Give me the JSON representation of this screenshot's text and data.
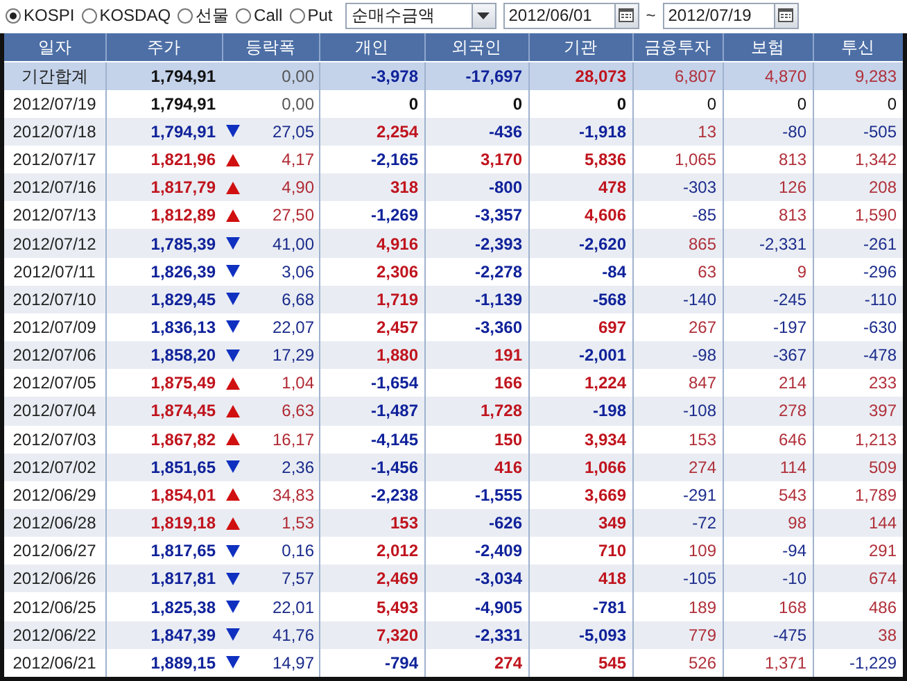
{
  "filters": [
    {
      "label": "KOSPI",
      "selected": true
    },
    {
      "label": "KOSDAQ",
      "selected": false
    },
    {
      "label": "선물",
      "selected": false
    },
    {
      "label": "Call",
      "selected": false
    },
    {
      "label": "Put",
      "selected": false
    }
  ],
  "measure": {
    "value": "순매수금액"
  },
  "date_from": {
    "value": "2012/06/01"
  },
  "range_separator": "~",
  "date_to": {
    "value": "2012/07/19"
  },
  "table": {
    "columns": [
      "일자",
      "주가",
      "등락폭",
      "개인",
      "외국인",
      "기관",
      "금융투자",
      "보험",
      "투신"
    ],
    "rows": [
      {
        "total": true,
        "date": "기간합계",
        "price": "1,794,91",
        "rising": false,
        "falling": false,
        "change": "0,00",
        "values": [
          {
            "text": "-3,978",
            "color": "#10229a"
          },
          {
            "text": "-17,697",
            "color": "#10229a"
          },
          {
            "text": "28,073",
            "color": "#c0141e"
          },
          {
            "text": "6,807",
            "color": "#b0303a"
          },
          {
            "text": "4,870",
            "color": "#b0303a"
          },
          {
            "text": "9,283",
            "color": "#b0303a"
          }
        ]
      },
      {
        "total": false,
        "date": "2012/07/19",
        "price": "1,794,91",
        "rising": false,
        "falling": false,
        "change": "0,00",
        "values": [
          {
            "text": "0",
            "color": "#111111"
          },
          {
            "text": "0",
            "color": "#111111"
          },
          {
            "text": "0",
            "color": "#111111"
          },
          {
            "text": "0",
            "color": "#111111"
          },
          {
            "text": "0",
            "color": "#111111"
          },
          {
            "text": "0",
            "color": "#111111"
          }
        ]
      },
      {
        "total": false,
        "date": "2012/07/18",
        "price": "1,794,91",
        "rising": false,
        "falling": true,
        "change": "27,05",
        "values": [
          {
            "text": "2,254",
            "color": "#c0141e"
          },
          {
            "text": "-436",
            "color": "#10229a"
          },
          {
            "text": "-1,918",
            "color": "#10229a"
          },
          {
            "text": "13",
            "color": "#b0303a"
          },
          {
            "text": "-80",
            "color": "#1c2c8c"
          },
          {
            "text": "-505",
            "color": "#1c2c8c"
          }
        ]
      },
      {
        "total": false,
        "date": "2012/07/17",
        "price": "1,821,96",
        "rising": true,
        "falling": false,
        "change": "4,17",
        "values": [
          {
            "text": "-2,165",
            "color": "#10229a"
          },
          {
            "text": "3,170",
            "color": "#c0141e"
          },
          {
            "text": "5,836",
            "color": "#c0141e"
          },
          {
            "text": "1,065",
            "color": "#b0303a"
          },
          {
            "text": "813",
            "color": "#b0303a"
          },
          {
            "text": "1,342",
            "color": "#b0303a"
          }
        ]
      },
      {
        "total": false,
        "date": "2012/07/16",
        "price": "1,817,79",
        "rising": true,
        "falling": false,
        "change": "4,90",
        "values": [
          {
            "text": "318",
            "color": "#c0141e"
          },
          {
            "text": "-800",
            "color": "#10229a"
          },
          {
            "text": "478",
            "color": "#c0141e"
          },
          {
            "text": "-303",
            "color": "#1c2c8c"
          },
          {
            "text": "126",
            "color": "#b0303a"
          },
          {
            "text": "208",
            "color": "#b0303a"
          }
        ]
      },
      {
        "total": false,
        "date": "2012/07/13",
        "price": "1,812,89",
        "rising": true,
        "falling": false,
        "change": "27,50",
        "values": [
          {
            "text": "-1,269",
            "color": "#10229a"
          },
          {
            "text": "-3,357",
            "color": "#10229a"
          },
          {
            "text": "4,606",
            "color": "#c0141e"
          },
          {
            "text": "-85",
            "color": "#1c2c8c"
          },
          {
            "text": "813",
            "color": "#b0303a"
          },
          {
            "text": "1,590",
            "color": "#b0303a"
          }
        ]
      },
      {
        "total": false,
        "date": "2012/07/12",
        "price": "1,785,39",
        "rising": false,
        "falling": true,
        "change": "41,00",
        "values": [
          {
            "text": "4,916",
            "color": "#c0141e"
          },
          {
            "text": "-2,393",
            "color": "#10229a"
          },
          {
            "text": "-2,620",
            "color": "#10229a"
          },
          {
            "text": "865",
            "color": "#b0303a"
          },
          {
            "text": "-2,331",
            "color": "#1c2c8c"
          },
          {
            "text": "-261",
            "color": "#1c2c8c"
          }
        ]
      },
      {
        "total": false,
        "date": "2012/07/11",
        "price": "1,826,39",
        "rising": false,
        "falling": true,
        "change": "3,06",
        "values": [
          {
            "text": "2,306",
            "color": "#c0141e"
          },
          {
            "text": "-2,278",
            "color": "#10229a"
          },
          {
            "text": "-84",
            "color": "#10229a"
          },
          {
            "text": "63",
            "color": "#b0303a"
          },
          {
            "text": "9",
            "color": "#b0303a"
          },
          {
            "text": "-296",
            "color": "#1c2c8c"
          }
        ]
      },
      {
        "total": false,
        "date": "2012/07/10",
        "price": "1,829,45",
        "rising": false,
        "falling": true,
        "change": "6,68",
        "values": [
          {
            "text": "1,719",
            "color": "#c0141e"
          },
          {
            "text": "-1,139",
            "color": "#10229a"
          },
          {
            "text": "-568",
            "color": "#10229a"
          },
          {
            "text": "-140",
            "color": "#1c2c8c"
          },
          {
            "text": "-245",
            "color": "#1c2c8c"
          },
          {
            "text": "-110",
            "color": "#1c2c8c"
          }
        ]
      },
      {
        "total": false,
        "date": "2012/07/09",
        "price": "1,836,13",
        "rising": false,
        "falling": true,
        "change": "22,07",
        "values": [
          {
            "text": "2,457",
            "color": "#c0141e"
          },
          {
            "text": "-3,360",
            "color": "#10229a"
          },
          {
            "text": "697",
            "color": "#c0141e"
          },
          {
            "text": "267",
            "color": "#b0303a"
          },
          {
            "text": "-197",
            "color": "#1c2c8c"
          },
          {
            "text": "-630",
            "color": "#1c2c8c"
          }
        ]
      },
      {
        "total": false,
        "date": "2012/07/06",
        "price": "1,858,20",
        "rising": false,
        "falling": true,
        "change": "17,29",
        "values": [
          {
            "text": "1,880",
            "color": "#c0141e"
          },
          {
            "text": "191",
            "color": "#c0141e"
          },
          {
            "text": "-2,001",
            "color": "#10229a"
          },
          {
            "text": "-98",
            "color": "#1c2c8c"
          },
          {
            "text": "-367",
            "color": "#1c2c8c"
          },
          {
            "text": "-478",
            "color": "#1c2c8c"
          }
        ]
      },
      {
        "total": false,
        "date": "2012/07/05",
        "price": "1,875,49",
        "rising": true,
        "falling": false,
        "change": "1,04",
        "values": [
          {
            "text": "-1,654",
            "color": "#10229a"
          },
          {
            "text": "166",
            "color": "#c0141e"
          },
          {
            "text": "1,224",
            "color": "#c0141e"
          },
          {
            "text": "847",
            "color": "#b0303a"
          },
          {
            "text": "214",
            "color": "#b0303a"
          },
          {
            "text": "233",
            "color": "#b0303a"
          }
        ]
      },
      {
        "total": false,
        "date": "2012/07/04",
        "price": "1,874,45",
        "rising": true,
        "falling": false,
        "change": "6,63",
        "values": [
          {
            "text": "-1,487",
            "color": "#10229a"
          },
          {
            "text": "1,728",
            "color": "#c0141e"
          },
          {
            "text": "-198",
            "color": "#10229a"
          },
          {
            "text": "-108",
            "color": "#1c2c8c"
          },
          {
            "text": "278",
            "color": "#b0303a"
          },
          {
            "text": "397",
            "color": "#b0303a"
          }
        ]
      },
      {
        "total": false,
        "date": "2012/07/03",
        "price": "1,867,82",
        "rising": true,
        "falling": false,
        "change": "16,17",
        "values": [
          {
            "text": "-4,145",
            "color": "#10229a"
          },
          {
            "text": "150",
            "color": "#c0141e"
          },
          {
            "text": "3,934",
            "color": "#c0141e"
          },
          {
            "text": "153",
            "color": "#b0303a"
          },
          {
            "text": "646",
            "color": "#b0303a"
          },
          {
            "text": "1,213",
            "color": "#b0303a"
          }
        ]
      },
      {
        "total": false,
        "date": "2012/07/02",
        "price": "1,851,65",
        "rising": false,
        "falling": true,
        "change": "2,36",
        "values": [
          {
            "text": "-1,456",
            "color": "#10229a"
          },
          {
            "text": "416",
            "color": "#c0141e"
          },
          {
            "text": "1,066",
            "color": "#c0141e"
          },
          {
            "text": "274",
            "color": "#b0303a"
          },
          {
            "text": "114",
            "color": "#b0303a"
          },
          {
            "text": "509",
            "color": "#b0303a"
          }
        ]
      },
      {
        "total": false,
        "date": "2012/06/29",
        "price": "1,854,01",
        "rising": true,
        "falling": false,
        "change": "34,83",
        "values": [
          {
            "text": "-2,238",
            "color": "#10229a"
          },
          {
            "text": "-1,555",
            "color": "#10229a"
          },
          {
            "text": "3,669",
            "color": "#c0141e"
          },
          {
            "text": "-291",
            "color": "#1c2c8c"
          },
          {
            "text": "543",
            "color": "#b0303a"
          },
          {
            "text": "1,789",
            "color": "#b0303a"
          }
        ]
      },
      {
        "total": false,
        "date": "2012/06/28",
        "price": "1,819,18",
        "rising": true,
        "falling": false,
        "change": "1,53",
        "values": [
          {
            "text": "153",
            "color": "#c0141e"
          },
          {
            "text": "-626",
            "color": "#10229a"
          },
          {
            "text": "349",
            "color": "#c0141e"
          },
          {
            "text": "-72",
            "color": "#1c2c8c"
          },
          {
            "text": "98",
            "color": "#b0303a"
          },
          {
            "text": "144",
            "color": "#b0303a"
          }
        ]
      },
      {
        "total": false,
        "date": "2012/06/27",
        "price": "1,817,65",
        "rising": false,
        "falling": true,
        "change": "0,16",
        "values": [
          {
            "text": "2,012",
            "color": "#c0141e"
          },
          {
            "text": "-2,409",
            "color": "#10229a"
          },
          {
            "text": "710",
            "color": "#c0141e"
          },
          {
            "text": "109",
            "color": "#b0303a"
          },
          {
            "text": "-94",
            "color": "#1c2c8c"
          },
          {
            "text": "291",
            "color": "#b0303a"
          }
        ]
      },
      {
        "total": false,
        "date": "2012/06/26",
        "price": "1,817,81",
        "rising": false,
        "falling": true,
        "change": "7,57",
        "values": [
          {
            "text": "2,469",
            "color": "#c0141e"
          },
          {
            "text": "-3,034",
            "color": "#10229a"
          },
          {
            "text": "418",
            "color": "#c0141e"
          },
          {
            "text": "-105",
            "color": "#1c2c8c"
          },
          {
            "text": "-10",
            "color": "#1c2c8c"
          },
          {
            "text": "674",
            "color": "#b0303a"
          }
        ]
      },
      {
        "total": false,
        "date": "2012/06/25",
        "price": "1,825,38",
        "rising": false,
        "falling": true,
        "change": "22,01",
        "values": [
          {
            "text": "5,493",
            "color": "#c0141e"
          },
          {
            "text": "-4,905",
            "color": "#10229a"
          },
          {
            "text": "-781",
            "color": "#10229a"
          },
          {
            "text": "189",
            "color": "#b0303a"
          },
          {
            "text": "168",
            "color": "#b0303a"
          },
          {
            "text": "486",
            "color": "#b0303a"
          }
        ]
      },
      {
        "total": false,
        "date": "2012/06/22",
        "price": "1,847,39",
        "rising": false,
        "falling": true,
        "change": "41,76",
        "values": [
          {
            "text": "7,320",
            "color": "#c0141e"
          },
          {
            "text": "-2,331",
            "color": "#10229a"
          },
          {
            "text": "-5,093",
            "color": "#10229a"
          },
          {
            "text": "779",
            "color": "#b0303a"
          },
          {
            "text": "-475",
            "color": "#1c2c8c"
          },
          {
            "text": "38",
            "color": "#b0303a"
          }
        ]
      },
      {
        "total": false,
        "date": "2012/06/21",
        "price": "1,889,15",
        "rising": false,
        "falling": true,
        "change": "14,97",
        "values": [
          {
            "text": "-794",
            "color": "#10229a"
          },
          {
            "text": "274",
            "color": "#c0141e"
          },
          {
            "text": "545",
            "color": "#c0141e"
          },
          {
            "text": "526",
            "color": "#b0303a"
          },
          {
            "text": "1,371",
            "color": "#b0303a"
          },
          {
            "text": "-1,229",
            "color": "#1c2c8c"
          }
        ]
      }
    ]
  }
}
